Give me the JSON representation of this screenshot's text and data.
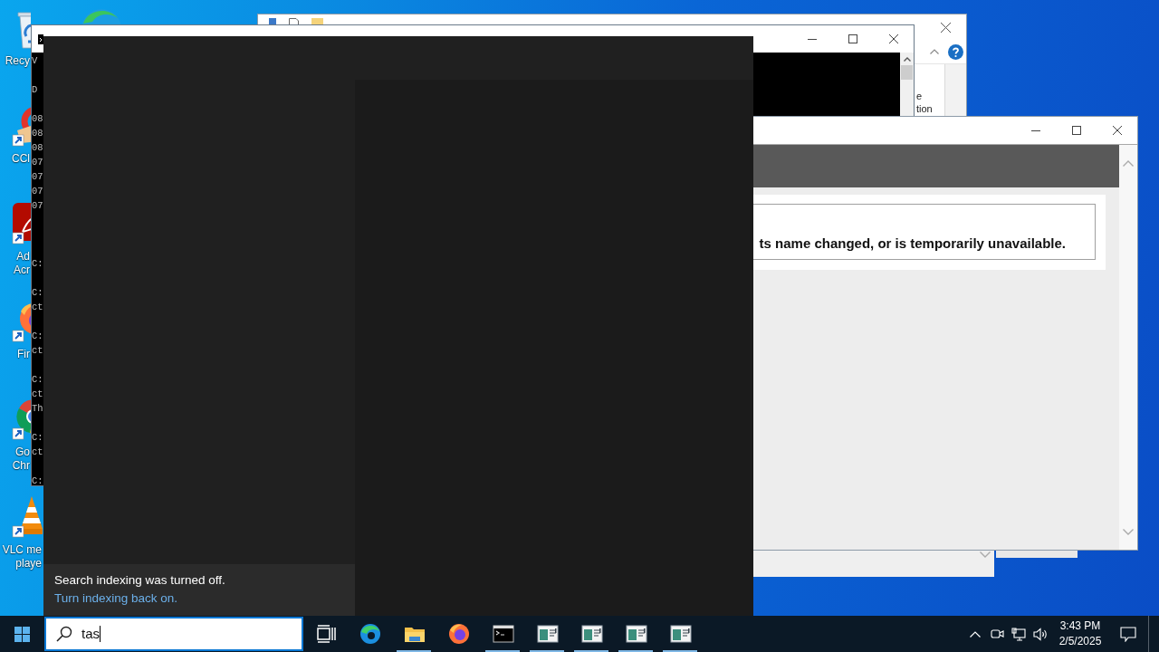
{
  "desktop": {
    "icons": [
      {
        "kind": "recycle",
        "lines": [
          "Recy"
        ]
      },
      {
        "kind": "ccleaner",
        "lines": [
          "CCl"
        ]
      },
      {
        "kind": "acrobat",
        "lines": [
          "Ad",
          "Acr"
        ]
      },
      {
        "kind": "firefox",
        "lines": [
          "Fir"
        ]
      },
      {
        "kind": "chrome",
        "lines": [
          "Go",
          "Chr"
        ]
      },
      {
        "kind": "vlc",
        "lines": [
          "VLC me",
          "playe"
        ]
      },
      {
        "kind": "edge"
      },
      {
        "kind": "document"
      }
    ]
  },
  "explorer_window": {
    "fragments": [
      "e",
      "tion"
    ]
  },
  "command_prompt": {
    "blocks": [
      [
        "V"
      ],
      [
        "D"
      ],
      [
        "08",
        "08",
        "08",
        "07",
        "07",
        "07",
        "07"
      ],
      [
        "C:"
      ],
      [
        "C:",
        "ct"
      ],
      [
        "C:",
        "ct"
      ],
      [
        "C:",
        "ct",
        "Th"
      ],
      [
        "C:",
        "ct"
      ],
      [
        "C:"
      ]
    ]
  },
  "browser_window": {
    "message": "ts name changed, or is temporarily unavailable."
  },
  "search_panel": {
    "notice": {
      "message": "Search indexing was turned off.",
      "link": "Turn indexing back on."
    }
  },
  "taskbar": {
    "search": {
      "value": "tas"
    },
    "apps": [
      {
        "kind": "task-view",
        "running": false
      },
      {
        "kind": "edge",
        "running": false
      },
      {
        "kind": "explorer",
        "running": true
      },
      {
        "kind": "firefox",
        "running": false
      },
      {
        "kind": "terminal",
        "running": true
      },
      {
        "kind": "app-window",
        "running": true
      },
      {
        "kind": "app-window",
        "running": true
      },
      {
        "kind": "app-window",
        "running": true
      },
      {
        "kind": "app-window",
        "running": true
      }
    ],
    "tray": {
      "time": "3:43 PM",
      "date": "2/5/2025"
    }
  }
}
